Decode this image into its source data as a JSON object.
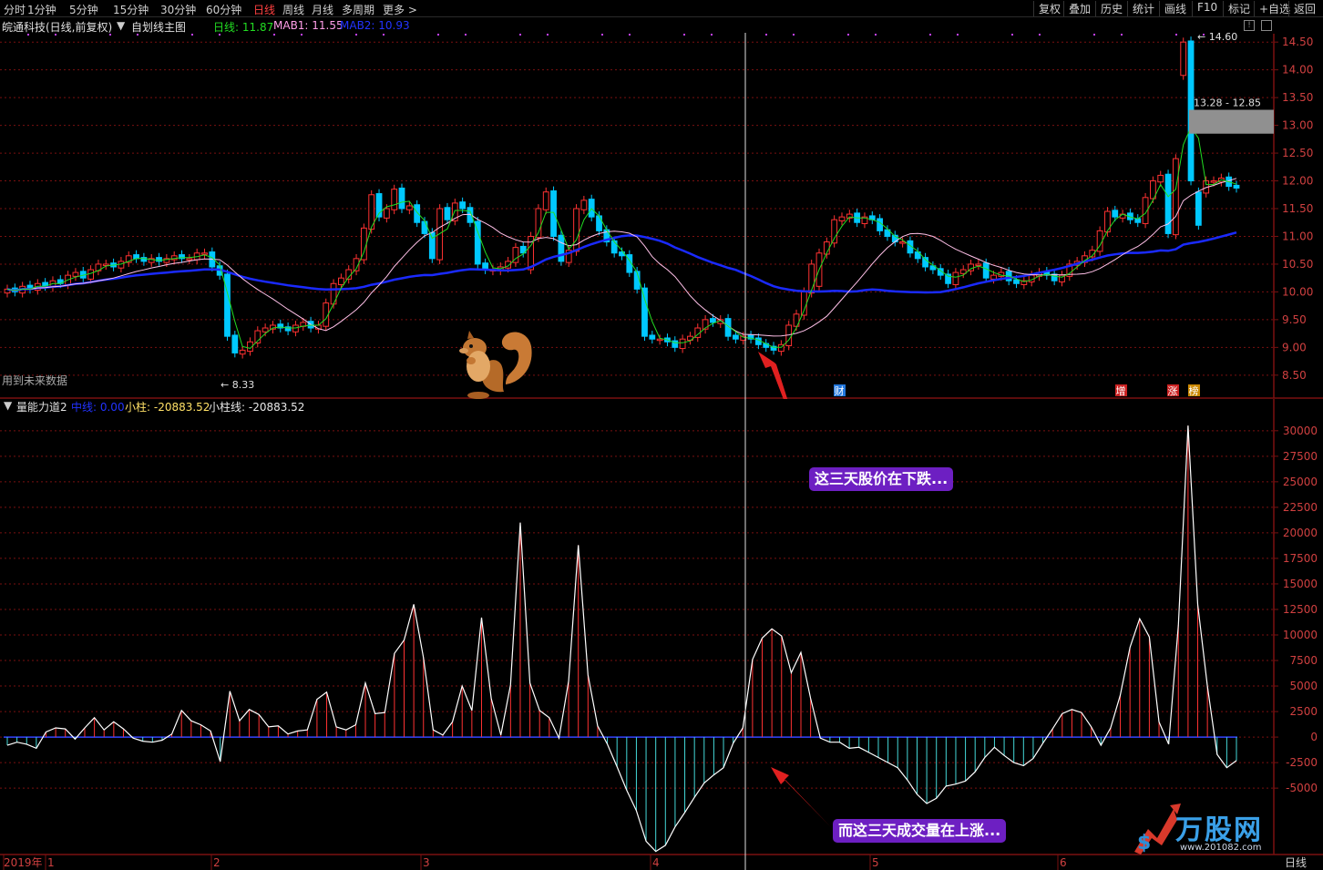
{
  "toolbar": {
    "periods": [
      "分时",
      "1分钟",
      "5分钟",
      "15分钟",
      "30分钟",
      "60分钟",
      "日线",
      "周线",
      "月线",
      "多周期",
      "更多 >"
    ],
    "active_index": 6,
    "right_tools": [
      "复权",
      "叠加",
      "历史",
      "统计",
      "画线",
      "F10",
      "标记",
      "+自选",
      "返回"
    ]
  },
  "info": {
    "stock_name": "皖通科技(日线,前复权)",
    "main_chart_label": "自划线主图",
    "day_line": "日线: 11.87",
    "mab1": "MAB1: 11.55",
    "mab2": "MAB2: 10.93",
    "future_data_note": "用到未来数据"
  },
  "price_axis": [
    "14.50",
    "14.00",
    "13.50",
    "13.00",
    "12.50",
    "12.00",
    "11.50",
    "11.00",
    "10.50",
    "10.00",
    "9.50",
    "9.00",
    "8.50"
  ],
  "price_annotations": {
    "high": "14.60",
    "low": "8.33",
    "range": "13.28 - 12.85"
  },
  "event_markers": [
    "财",
    "增",
    "涨",
    "榜"
  ],
  "indicator": {
    "name": "量能力道2",
    "center_line": "中线: 0.00",
    "small_bar": "小柱: -20883.52",
    "small_bar_line": "小柱线: -20883.52"
  },
  "indicator_axis": [
    "30000",
    "27500",
    "25000",
    "22500",
    "20000",
    "17500",
    "15000",
    "12500",
    "10000",
    "7500",
    "5000",
    "2500",
    "0",
    "-2500",
    "-5000"
  ],
  "time_axis": [
    "2019年",
    "1",
    "2",
    "3",
    "4",
    "5",
    "6"
  ],
  "period_label": "日线",
  "callouts": {
    "price_falling": "这三天股价在下跌...",
    "volume_rising": "而这三天成交量在上涨..."
  },
  "watermark": {
    "brand": "万股网",
    "url": "www.201082.com"
  },
  "colors": {
    "up": "#ff3232",
    "down": "#00c8ff",
    "ma_blue": "#1a2aff",
    "ma_pink": "#ffc0e8",
    "day_green": "#22dd22",
    "grid": "#7a1010",
    "callout_bg": "#6d1fc2"
  },
  "chart_data": {
    "type": "candlestick",
    "x_ticks": [
      "2019年",
      "1",
      "2",
      "3",
      "4",
      "5",
      "6"
    ],
    "price_range": [
      8.3,
      14.7
    ],
    "indicator_range": [
      -11500,
      31500
    ],
    "closes": [
      10.05,
      10.0,
      10.1,
      10.05,
      10.15,
      10.1,
      10.2,
      10.15,
      10.3,
      10.35,
      10.25,
      10.4,
      10.5,
      10.5,
      10.45,
      10.55,
      10.65,
      10.6,
      10.55,
      10.6,
      10.55,
      10.6,
      10.65,
      10.6,
      10.6,
      10.7,
      10.7,
      10.45,
      10.3,
      9.2,
      8.9,
      8.95,
      9.1,
      9.3,
      9.35,
      9.4,
      9.35,
      9.3,
      9.4,
      9.45,
      9.35,
      9.4,
      9.8,
      10.15,
      10.25,
      10.4,
      10.6,
      11.15,
      11.75,
      11.35,
      11.5,
      11.85,
      11.5,
      11.55,
      11.25,
      11.05,
      10.6,
      11.5,
      11.3,
      11.6,
      11.5,
      11.25,
      10.5,
      10.4,
      10.4,
      10.45,
      10.55,
      10.8,
      10.7,
      11.0,
      11.5,
      11.8,
      11.0,
      10.55,
      10.75,
      11.5,
      11.65,
      11.35,
      11.1,
      10.9,
      10.7,
      10.65,
      10.35,
      10.05,
      9.2,
      9.15,
      9.15,
      9.1,
      9.0,
      9.15,
      9.2,
      9.35,
      9.5,
      9.45,
      9.5,
      9.2,
      9.15,
      9.2,
      9.15,
      9.05,
      9.0,
      8.95,
      9.05,
      9.4,
      9.6,
      10.0,
      10.5,
      10.7,
      10.9,
      11.3,
      11.35,
      11.4,
      11.25,
      11.35,
      11.3,
      11.1,
      11.0,
      10.9,
      10.9,
      10.7,
      10.6,
      10.45,
      10.4,
      10.3,
      10.15,
      10.35,
      10.4,
      10.5,
      10.5,
      10.25,
      10.3,
      10.35,
      10.2,
      10.15,
      10.2,
      10.3,
      10.35,
      10.3,
      10.2,
      10.3,
      10.5,
      10.55,
      10.65,
      10.75,
      11.1,
      11.45,
      11.35,
      11.4,
      11.3,
      11.25,
      11.7,
      12.0,
      12.1,
      11.05,
      12.4,
      14.5,
      12.0,
      11.8,
      12.0,
      12.0,
      12.05,
      11.9,
      11.87
    ],
    "indicator_series": [
      -800,
      -500,
      -700,
      -1100,
      500,
      900,
      800,
      -200,
      900,
      1900,
      700,
      1500,
      800,
      -100,
      -400,
      -500,
      -300,
      300,
      2600,
      1600,
      1200,
      600,
      -2400,
      4500,
      1600,
      2700,
      2200,
      1000,
      1100,
      300,
      600,
      700,
      3700,
      4400,
      1000,
      700,
      1200,
      5300,
      2300,
      2400,
      8200,
      9500,
      13000,
      7800,
      700,
      200,
      1500,
      5000,
      2600,
      11700,
      3800,
      200,
      5100,
      21000,
      5300,
      2600,
      1900,
      -100,
      5500,
      18800,
      6100,
      1100,
      -700,
      -2900,
      -5200,
      -7200,
      -10200,
      -11200,
      -10600,
      -8800,
      -7400,
      -5900,
      -4500,
      -3700,
      -3000,
      -600,
      900,
      7600,
      9700,
      10600,
      9900,
      6300,
      8300,
      3800,
      -100,
      -500,
      -500,
      -1100,
      -1000,
      -1500,
      -2000,
      -2500,
      -3000,
      -4200,
      -5600,
      -6500,
      -6000,
      -4800,
      -4600,
      -4300,
      -3400,
      -2000,
      -1000,
      -1800,
      -2500,
      -2800,
      -2100,
      -600,
      800,
      2300,
      2700,
      2400,
      1000,
      -800,
      900,
      4100,
      8800,
      11600,
      9800,
      1500,
      -700,
      11000,
      30500,
      13000,
      5000,
      -1700,
      -3000,
      -2300
    ]
  }
}
